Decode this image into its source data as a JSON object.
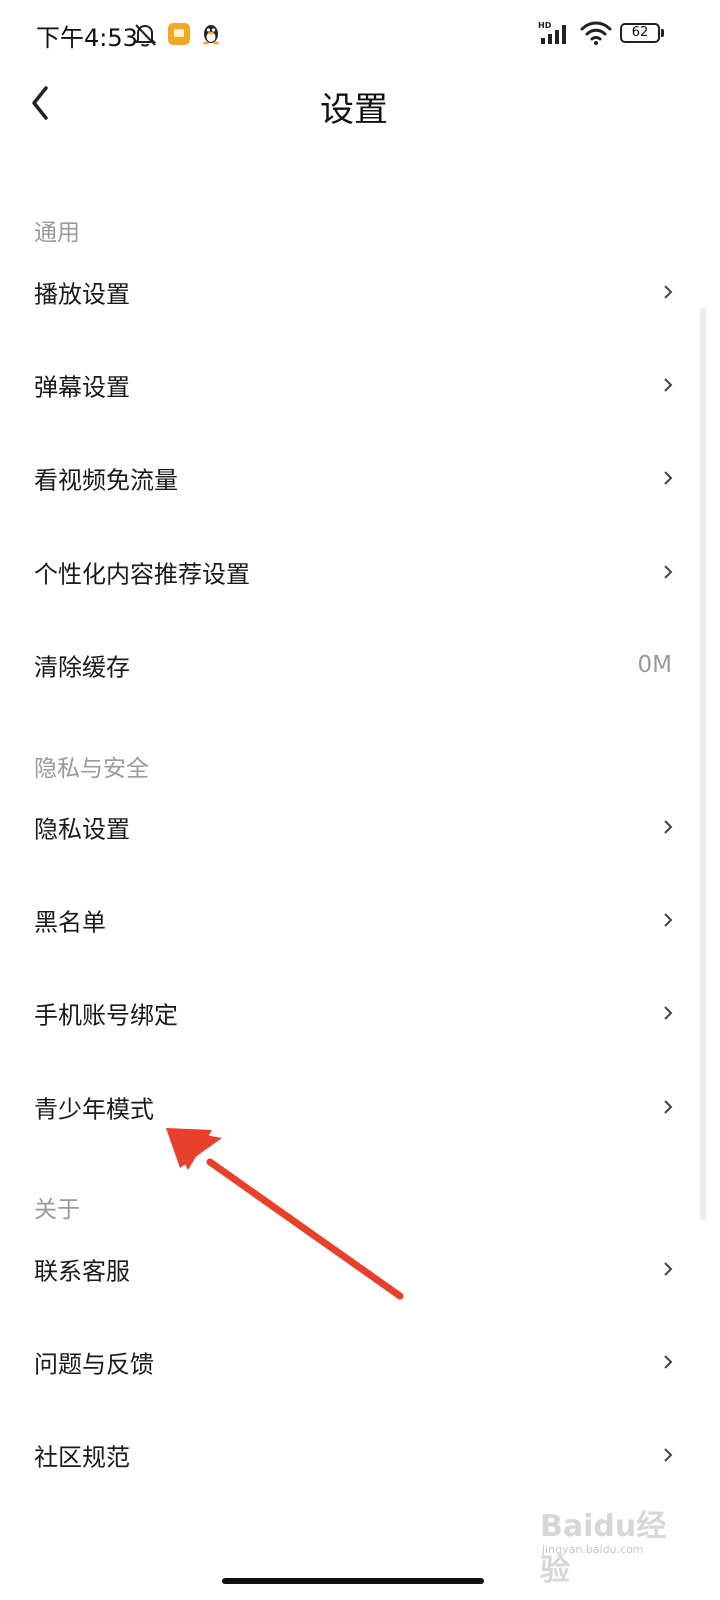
{
  "status_bar": {
    "time": "下午4:53",
    "battery": "62",
    "icons": [
      "bell-off-icon",
      "notification-app-icon",
      "qq-penguin-icon",
      "hd-signal-icon",
      "wifi-icon",
      "battery-icon"
    ]
  },
  "header": {
    "title": "设置",
    "back_icon": "chevron-left-icon"
  },
  "sections": {
    "general": {
      "title": "通用",
      "items": [
        {
          "label": "播放设置"
        },
        {
          "label": "弹幕设置"
        },
        {
          "label": "看视频免流量"
        },
        {
          "label": "个性化内容推荐设置"
        },
        {
          "label": "清除缓存",
          "value": "0M"
        }
      ]
    },
    "privacy": {
      "title": "隐私与安全",
      "items": [
        {
          "label": "隐私设置"
        },
        {
          "label": "黑名单"
        },
        {
          "label": "手机账号绑定"
        },
        {
          "label": "青少年模式"
        }
      ]
    },
    "about": {
      "title": "关于",
      "items": [
        {
          "label": "联系客服"
        },
        {
          "label": "问题与反馈"
        },
        {
          "label": "社区规范"
        }
      ]
    }
  },
  "watermark": {
    "text": "Baidu经验",
    "url": "jingyan.baidu.com"
  },
  "colors": {
    "annotation_arrow": "#e8402a",
    "section_header": "#9a9a9a"
  }
}
